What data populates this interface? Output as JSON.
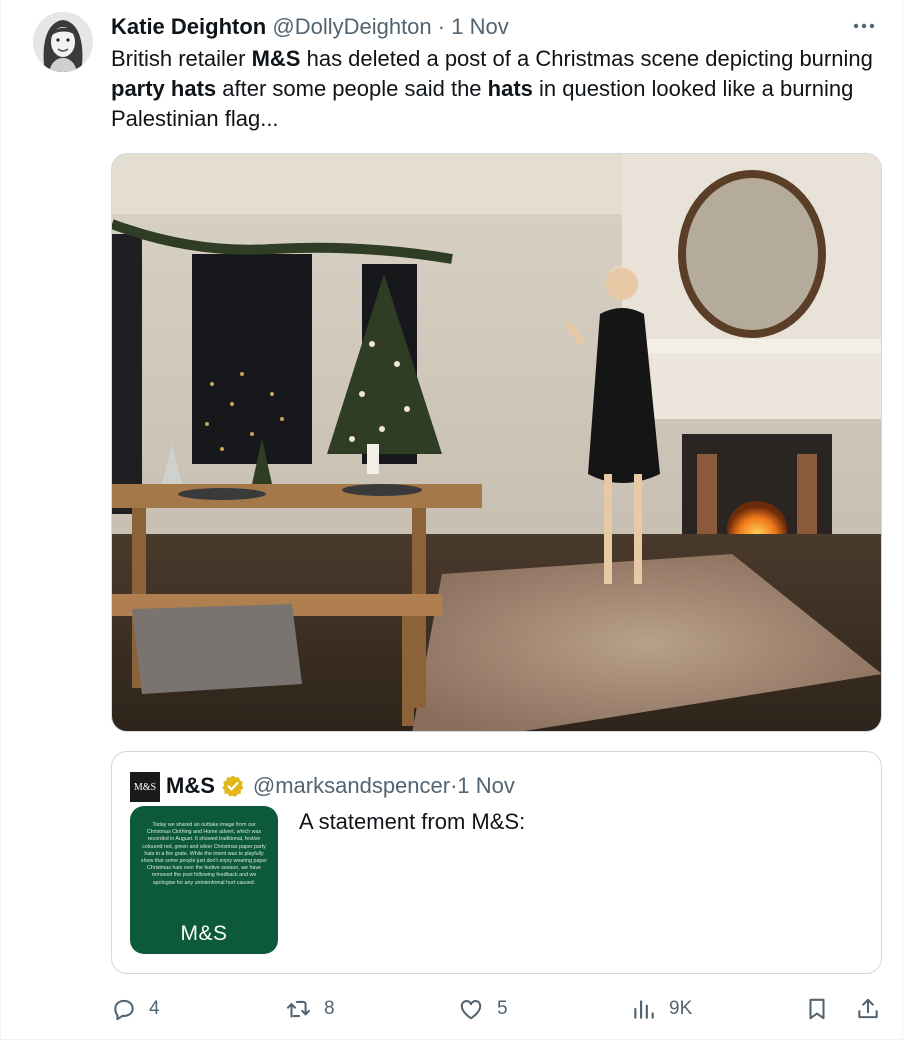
{
  "tweet": {
    "author_name": "Katie Deighton",
    "author_handle": "@DollyDeighton",
    "separator": "·",
    "time": "1 Nov",
    "text_parts": {
      "p1": "British retailer ",
      "b1": "M&S",
      "p2": " has deleted a post of a Christmas scene depicting burning ",
      "b2": "party hats",
      "p3": " after some people said the ",
      "b3": "hats",
      "p4": " in question looked like a burning Palestinian flag..."
    }
  },
  "quoted": {
    "logo_text": "M&S",
    "name": "M&S",
    "handle": "@marksandspencer",
    "separator": "·",
    "time": "1 Nov",
    "text": "A statement from M&S:",
    "card_text": "Today we shared an outtake image from our Christmas Clothing and Home advert, which was recorded in August. It showed traditional, festive coloured red, green and silver Christmas paper party hats in a fire grate. While the intent was to playfully show that some people just don't enjoy wearing paper Christmas hats over the festive season, we have removed the post following feedback and we apologise for any unintentional hurt caused.",
    "card_logo": "M&S",
    "card_color": "#0d5a3b"
  },
  "actions": {
    "replies": "4",
    "reposts": "8",
    "likes": "5",
    "views": "9K"
  },
  "icons": {
    "more": "more-dots-icon",
    "reply": "reply-icon",
    "repost": "repost-icon",
    "like": "heart-icon",
    "views": "views-chart-icon",
    "bookmark": "bookmark-icon",
    "share": "share-icon",
    "verified": "verified-badge-icon"
  },
  "colors": {
    "text": "#0f1419",
    "secondary": "#536471",
    "border": "#cfd9de",
    "verified_gold": "#e2b719"
  }
}
